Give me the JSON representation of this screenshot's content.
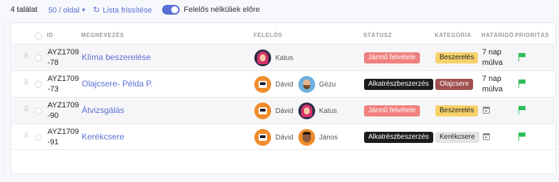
{
  "toolbar": {
    "count_label": "4 találat",
    "per_page_label": "50 / oldal",
    "refresh_label": "Lista frissítése",
    "toggle_label": "Felelős nélküliek előre",
    "toggle_on": true
  },
  "table": {
    "headers": {
      "id": "ID",
      "name": "MEGNEVEZÉS",
      "responsible": "FELELŐS",
      "status": "STÁTUSZ",
      "category": "KATEGÓRIA",
      "deadline": "HATÁRIDŐ",
      "priority": "PRIORITÁS"
    },
    "rows": [
      {
        "id": "AYZ1709-78",
        "name": "Klíma beszerelése",
        "people": [
          {
            "name": "Katus",
            "avatar": "woman"
          }
        ],
        "status": "Jármű felvétele",
        "category": "Beszerelés",
        "deadline": "7 nap múlva"
      },
      {
        "id": "AYZ1709-73",
        "name": "Olajcsere- Példa P.",
        "people": [
          {
            "name": "Dávid",
            "avatar": "robot"
          },
          {
            "name": "Gézu",
            "avatar": "man1"
          }
        ],
        "status": "Alkatrészbeszerzés",
        "category": "Olajcsere",
        "deadline": "7 nap múlva"
      },
      {
        "id": "AYZ1709-90",
        "name": "Átvizsgálás",
        "people": [
          {
            "name": "Dávid",
            "avatar": "robot"
          },
          {
            "name": "Katus",
            "avatar": "woman"
          }
        ],
        "status": "Jármű felvétele",
        "category": "Beszerelés",
        "deadline": ""
      },
      {
        "id": "AYZ1709-91",
        "name": "Kerékcsere",
        "people": [
          {
            "name": "Dávid",
            "avatar": "robot"
          },
          {
            "name": "János",
            "avatar": "man2"
          }
        ],
        "status": "Alkatrészbeszerzés",
        "category": "Kerékcsere",
        "deadline": ""
      }
    ]
  },
  "colors": {
    "accent": "#5a6fd6",
    "status_vehicle": "#f08080",
    "status_parts": "#1c1c1c",
    "category_install": "#f7d26b",
    "category_oil": "#a05050",
    "category_tire": "#e4e4e4",
    "priority_flag": "#2fbf5a"
  },
  "icons": {
    "drag": "drag-handle-icon",
    "refresh": "refresh-icon",
    "calendar": "calendar-icon",
    "priority": "flag-icon"
  }
}
